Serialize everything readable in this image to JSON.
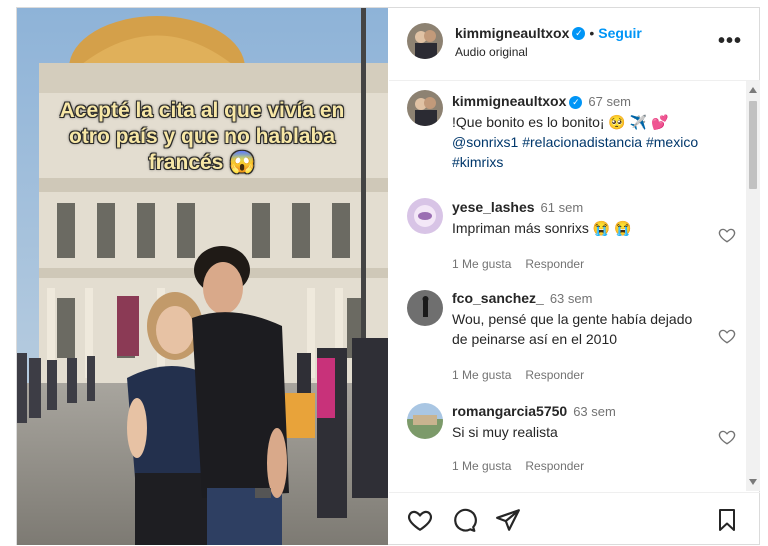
{
  "media": {
    "overlay_text": "Acepté la cita al que vivía en otro país y que no hablaba francés 😱"
  },
  "header": {
    "username": "kimmigneaultxox",
    "follow_label": "Seguir",
    "subtitle": "Audio original",
    "more_label": "•••"
  },
  "caption": {
    "username": "kimmigneaultxox",
    "time": "67 sem",
    "text_start": "!Que bonito es lo bonito¡ 🥺 ✈️ 💕",
    "mention": "@sonrixs1",
    "tags": "#relacionadistancia #mexico #kimrixs"
  },
  "comments": [
    {
      "username": "yese_lashes",
      "time": "61 sem",
      "text": "Impriman más sonrixs 😭 😭",
      "likes": "1 Me gusta",
      "reply": "Responder"
    },
    {
      "username": "fco_sanchez_",
      "time": "63 sem",
      "text": "Wou, pensé que la gente había dejado de peinarse así en el 2010",
      "likes": "1 Me gusta",
      "reply": "Responder"
    },
    {
      "username": "romangarcia5750",
      "time": "63 sem",
      "text": "Si si muy realista",
      "likes": "1 Me gusta",
      "reply": "Responder"
    }
  ],
  "colors": {
    "accent": "#0095f6",
    "text": "#262626",
    "muted": "#737373"
  }
}
